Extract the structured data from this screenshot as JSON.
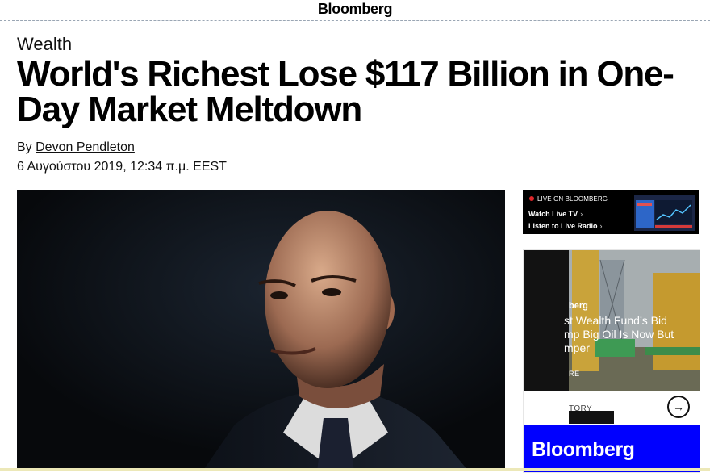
{
  "masthead": {
    "logo": "Bloomberg"
  },
  "article": {
    "section": "Wealth",
    "headline": "World's Richest Lose $117 Billion in One-Day Market Meltdown",
    "byline_prefix": "By",
    "author": "Devon Pendleton",
    "date": "6 Αυγούστου 2019, 12:34 π.μ. EEST"
  },
  "live": {
    "label": "LIVE ON BLOOMBERG",
    "watch": "Watch Live TV",
    "listen": "Listen to Live Radio"
  },
  "ad": {
    "brand_partial": "berg",
    "title_partial": "st Wealth Fund’s Bid\nmp Big Oil Is Now But\nmper",
    "read_more_partial": "RE",
    "next_story_partial": "TORY",
    "footer_logo": "Bloomberg"
  },
  "colors": {
    "live_dot": "#e0262a",
    "ad_blue": "#0000ff",
    "hero_bg": "#0b0f14"
  }
}
